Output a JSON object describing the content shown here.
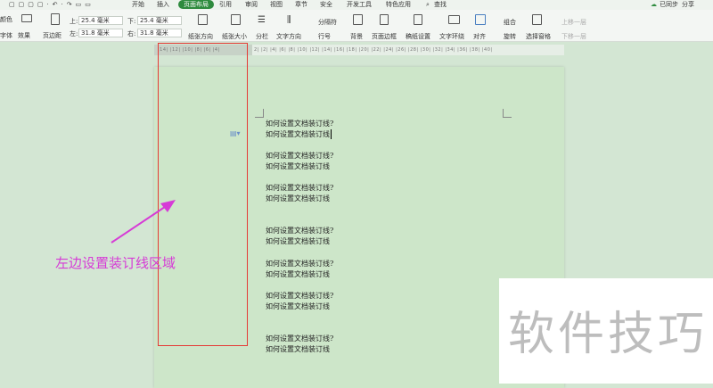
{
  "menu": {
    "tabs": [
      "开始",
      "插入",
      "页面布局",
      "引用",
      "审阅",
      "视图",
      "章节",
      "安全",
      "开发工具",
      "特色应用"
    ],
    "active": "页面布局",
    "search": "查找",
    "sync": "已同步",
    "share": "分享"
  },
  "toolbar": {
    "color": "颜色",
    "font": "字体",
    "effect": "效果",
    "margins": "页边距",
    "top_label": "上:",
    "top_value": "25.4 毫米",
    "bottom_label": "下:",
    "bottom_value": "25.4 毫米",
    "left_label": "左:",
    "left_value": "31.8 毫米",
    "right_label": "右:",
    "right_value": "31.8 毫米",
    "orientation": "纸张方向",
    "size": "纸张大小",
    "columns": "分栏",
    "text_direction": "文字方向",
    "separator": "分隔符",
    "line_number": "行号",
    "background": "背景",
    "page_border": "页面边框",
    "draft_settings": "稿纸设置",
    "text_wrap": "文字环绕",
    "align": "对齐",
    "group": "组合",
    "rotate": "旋转",
    "selection_pane": "选择窗格",
    "bring_forward": "上移一层",
    "send_backward": "下移一层"
  },
  "ruler": {
    "left": "|14| |12| |10| |8| |6| |4| ",
    "right": "2| |2| |4| |6| |8| |10| |12| |14| |16| |18| |20| |22| |24| |26| |28| |30| |32| |34| |36| |38| |40|"
  },
  "document": {
    "lines": [
      "如何设置文档装订线?",
      "如何设置文档装订线",
      "如何设置文档装订线?",
      "如何设置文档装订线",
      "如何设置文档装订线?",
      "如何设置文档装订线",
      "如何设置文档装订线?",
      "如何设置文档装订线",
      "如何设置文档装订线?",
      "如何设置文档装订线",
      "如何设置文档装订线?",
      "如何设置文档装订线",
      "如何设置文档装订线?",
      "如何设置文档装订线"
    ]
  },
  "annotation": {
    "text": "左边设置装订线区域",
    "color": "#d63bd6",
    "box_color": "#e53935"
  },
  "watermark": "软件技巧"
}
